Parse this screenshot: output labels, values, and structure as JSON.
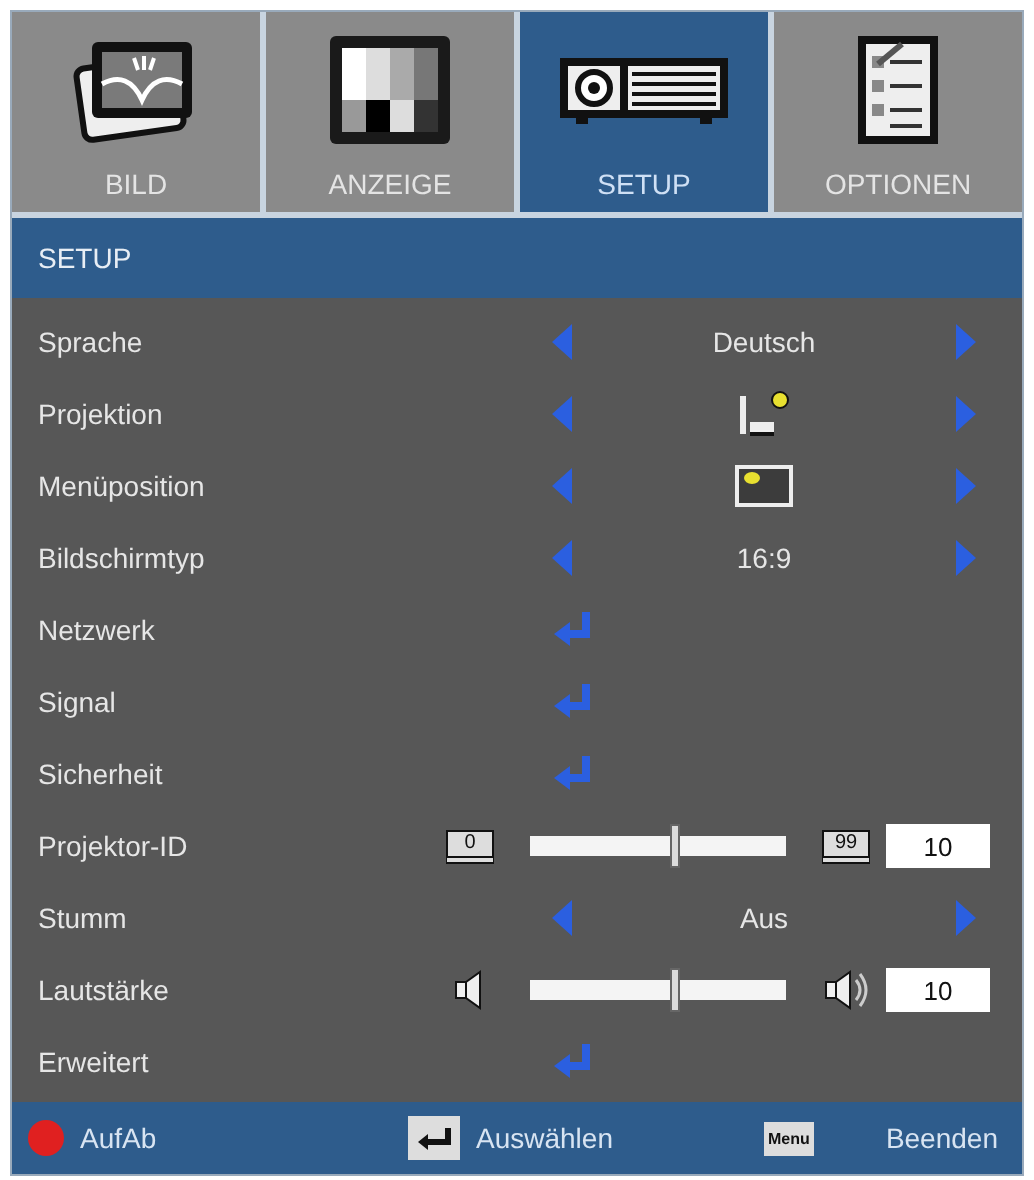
{
  "tabs": [
    {
      "label": "BILD",
      "kind": "picture",
      "selected": false
    },
    {
      "label": "ANZEIGE",
      "kind": "display",
      "selected": false
    },
    {
      "label": "SETUP",
      "kind": "projector",
      "selected": true
    },
    {
      "label": "OPTIONEN",
      "kind": "checklist",
      "selected": false
    }
  ],
  "header": "SETUP",
  "rows": [
    {
      "kind": "select",
      "label": "Sprache",
      "value": "Deutsch"
    },
    {
      "kind": "projection",
      "label": "Projektion"
    },
    {
      "kind": "position",
      "label": "Menüposition"
    },
    {
      "kind": "select",
      "label": "Bildschirmtyp",
      "value": "16:9"
    },
    {
      "kind": "enter",
      "label": "Netzwerk"
    },
    {
      "kind": "enter",
      "label": "Signal"
    },
    {
      "kind": "enter",
      "label": "Sicherheit"
    },
    {
      "kind": "idslider",
      "label": "Projektor-ID",
      "min_label": "0",
      "max_label": "99",
      "level": 0.57,
      "value": "10"
    },
    {
      "kind": "select",
      "label": "Stumm",
      "value": "Aus"
    },
    {
      "kind": "volume",
      "label": "Lautstärke",
      "level": 0.57,
      "value": "10"
    },
    {
      "kind": "enter",
      "label": "Erweitert"
    }
  ],
  "footer": [
    {
      "kind": "updown",
      "label": "AufAb"
    },
    {
      "kind": "enter",
      "label": "Auswählen"
    },
    {
      "kind": "menu",
      "key": "Menu",
      "label": "Beenden"
    }
  ]
}
